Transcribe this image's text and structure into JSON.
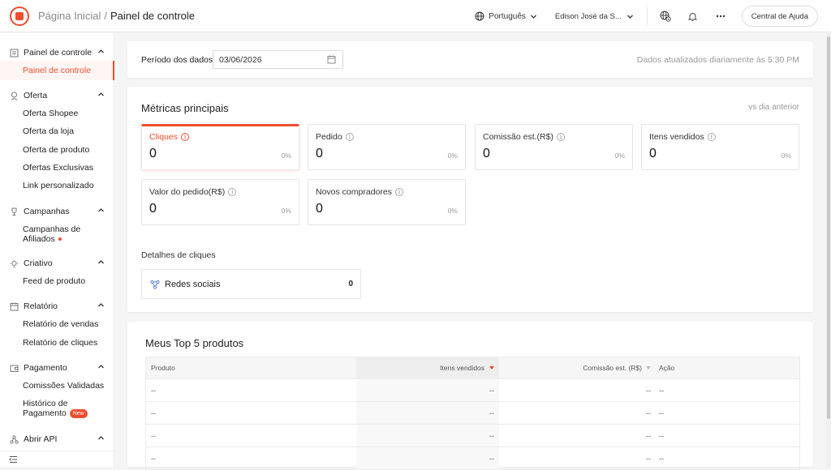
{
  "header": {
    "breadcrumb_home": "Página Inicial",
    "breadcrumb_sep": "/",
    "breadcrumb_current": "Painel de controle",
    "language": "Português",
    "user_name": "Edison José da S...",
    "help_label": "Central de Ajuda"
  },
  "sidebar": {
    "groups": [
      {
        "label": "Painel de controle",
        "icon": "dashboard-icon",
        "items": [
          "Painel de controle"
        ]
      },
      {
        "label": "Oferta",
        "icon": "offer-icon",
        "items": [
          "Oferta Shopee",
          "Oferta da loja",
          "Oferta de produto",
          "Ofertas Exclusivas",
          "Link personalizado"
        ]
      },
      {
        "label": "Campanhas",
        "icon": "trophy-icon",
        "items": [
          "Campanhas de",
          "Afiliados"
        ]
      },
      {
        "label": "Criativo",
        "icon": "bulb-icon",
        "items": [
          "Feed de produto"
        ]
      },
      {
        "label": "Relatório",
        "icon": "calendar-icon",
        "items": [
          "Relatório de vendas",
          "Relatório de cliques"
        ]
      },
      {
        "label": "Pagamento",
        "icon": "wallet-icon",
        "items": [
          "Comissões Validadas",
          "Histórico de",
          "Pagamento"
        ]
      },
      {
        "label": "Abrir API",
        "icon": "api-icon",
        "items": []
      }
    ],
    "new_badge": "New"
  },
  "period": {
    "label": "Período dos dados",
    "date_value": "03/06/2026",
    "note": "Dados atualizados diariamente às 5:30 PM"
  },
  "metrics": {
    "title": "Métricas principais",
    "compare": "vs dia anterior",
    "cards": [
      {
        "label": "Cliques",
        "value": "0",
        "pct": "0%"
      },
      {
        "label": "Pedido",
        "value": "0",
        "pct": "0%"
      },
      {
        "label": "Comissão est.(R$)",
        "value": "0",
        "pct": "0%"
      },
      {
        "label": "Itens vendidos",
        "value": "0",
        "pct": "0%"
      },
      {
        "label": "Valor do pedido(R$)",
        "value": "0",
        "pct": "0%"
      },
      {
        "label": "Novos compradores",
        "value": "0",
        "pct": "0%"
      }
    ],
    "click_details_label": "Detalhes de cliques",
    "social_label": "Redes sociais",
    "social_value": "0"
  },
  "top_products": {
    "title": "Meus Top 5 produtos",
    "columns": [
      "Produto",
      "Itens vendidos",
      "Comissão est. (R$)",
      "Ação"
    ],
    "rows": [
      [
        "--",
        "--",
        "--",
        "--"
      ],
      [
        "--",
        "--",
        "--",
        "--"
      ],
      [
        "--",
        "--",
        "--",
        "--"
      ],
      [
        "--",
        "--",
        "--",
        "--"
      ]
    ]
  },
  "colors": {
    "accent": "#ee4d2d",
    "background": "#f5f5f5"
  }
}
